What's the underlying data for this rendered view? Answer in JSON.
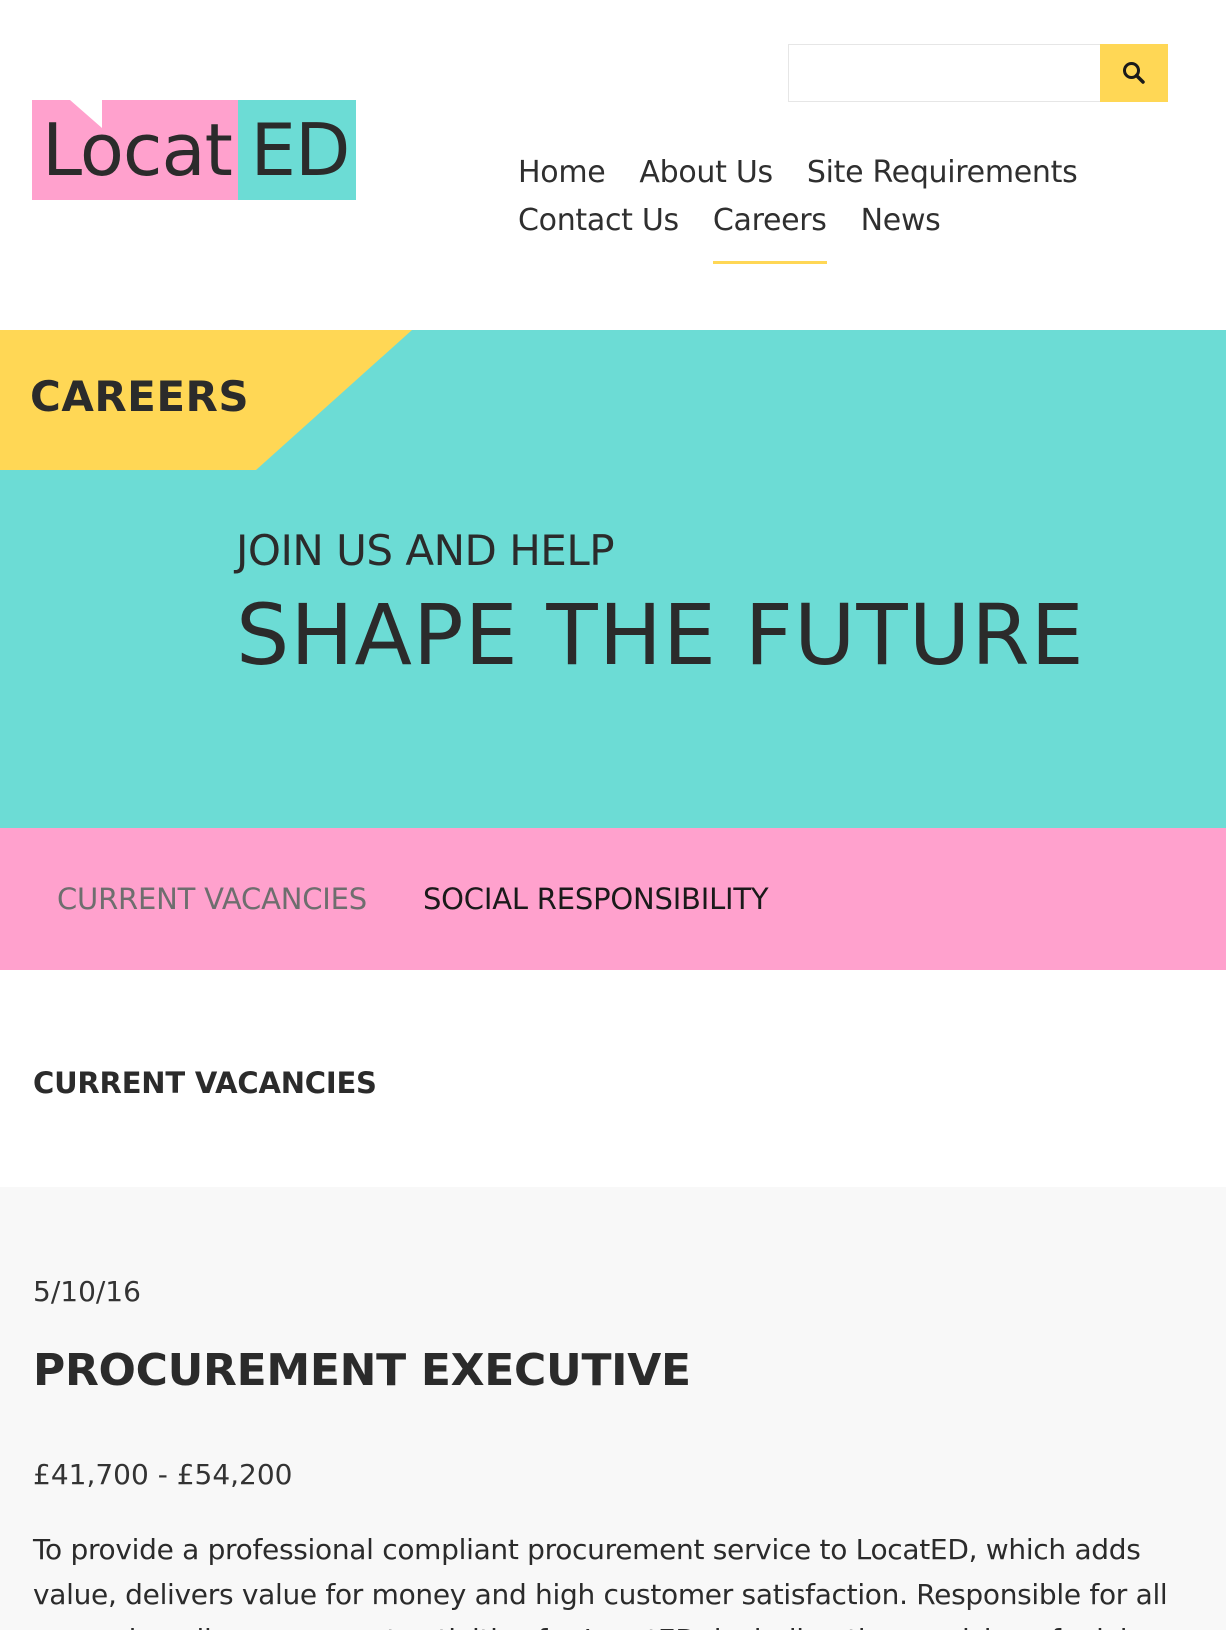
{
  "header": {
    "search": {
      "placeholder": "",
      "value": ""
    },
    "logo": {
      "left_text": "Locat",
      "right_text": "ED"
    },
    "nav": {
      "row1": [
        "Home",
        "About Us",
        "Site Requirements"
      ],
      "row2": [
        "Contact Us",
        "Careers",
        "News"
      ],
      "active": "Careers"
    }
  },
  "hero": {
    "tag": "CAREERS",
    "subtitle": "JOIN US AND HELP",
    "title": "SHAPE THE FUTURE"
  },
  "subnav": {
    "items": [
      "CURRENT VACANCIES",
      "SOCIAL RESPONSIBILITY"
    ]
  },
  "section": {
    "title": "CURRENT VACANCIES"
  },
  "vacancy": {
    "date": "5/10/16",
    "title": "PROCUREMENT EXECUTIVE",
    "salary": "£41,700 - £54,200",
    "description": "To provide a professional compliant procurement service to LocatED, which adds value, delivers value for money and high customer satisfaction. Responsible for all managing all procurement activities for LocatED, including the provision of advice, contracts and"
  },
  "colors": {
    "yellow": "#ffd755",
    "teal": "#6cdcd5",
    "pink": "#ffa1cd",
    "text": "#2b2b2b"
  }
}
